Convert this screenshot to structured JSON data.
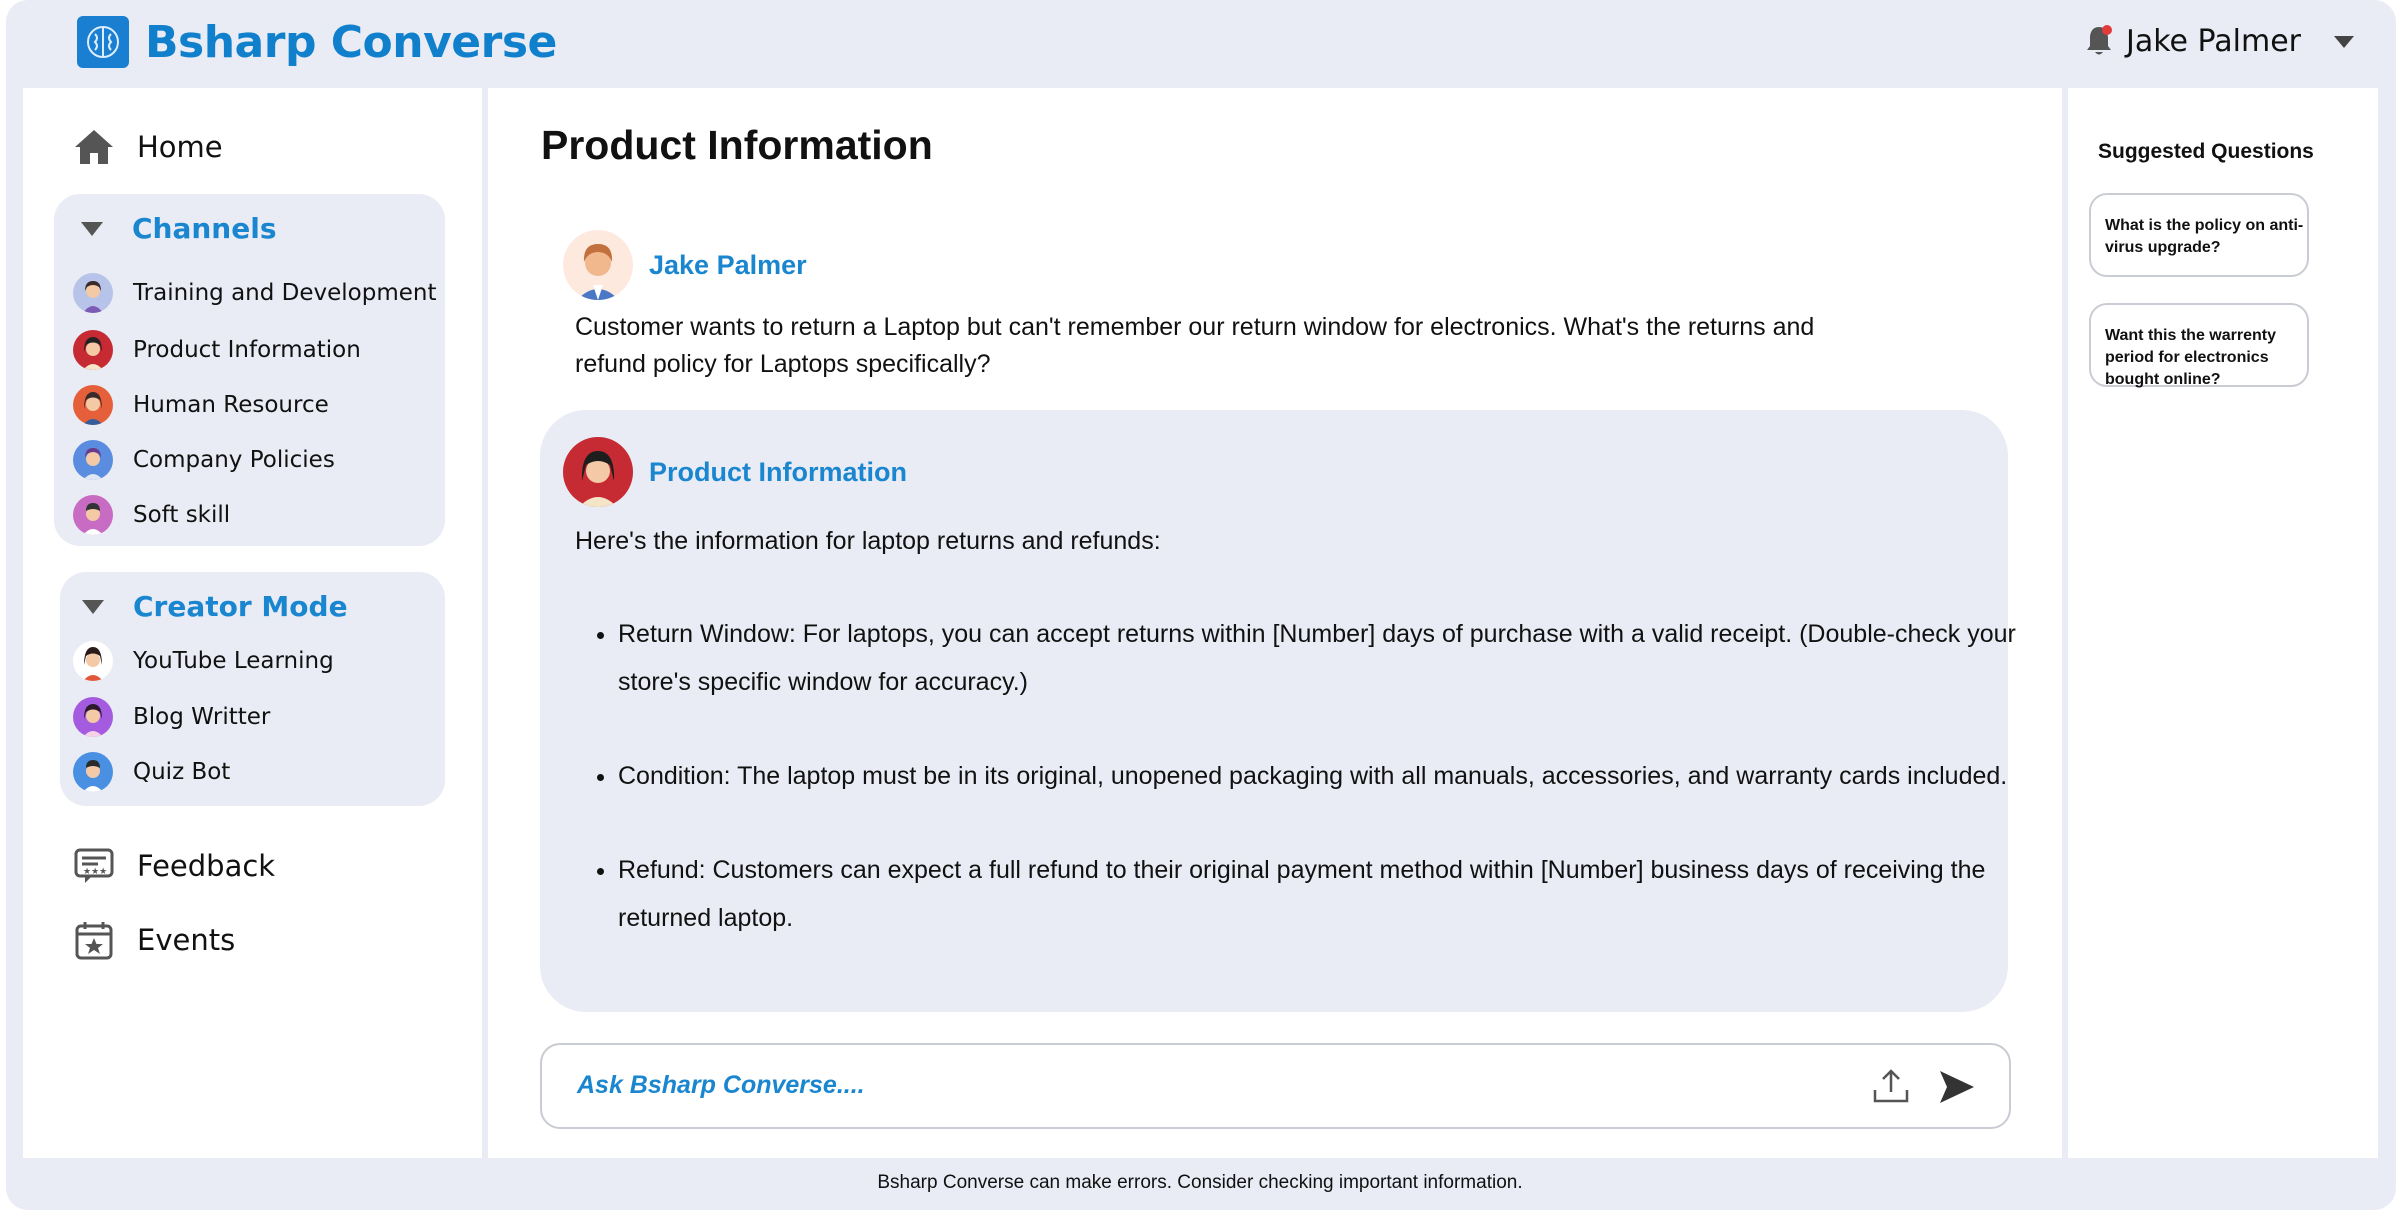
{
  "header": {
    "brand": "Bsharp Converse",
    "user_name": "Jake Palmer"
  },
  "sidebar": {
    "home_label": "Home",
    "channels": {
      "title": "Channels",
      "items": [
        {
          "label": "Training and Development"
        },
        {
          "label": "Product Information"
        },
        {
          "label": "Human Resource"
        },
        {
          "label": "Company Policies"
        },
        {
          "label": "Soft skill"
        }
      ]
    },
    "creator": {
      "title": "Creator Mode",
      "items": [
        {
          "label": "YouTube Learning"
        },
        {
          "label": "Blog Writter"
        },
        {
          "label": "Quiz Bot"
        }
      ]
    },
    "feedback_label": "Feedback",
    "events_label": "Events"
  },
  "main": {
    "title": "Product Information",
    "user_message": {
      "sender": "Jake Palmer",
      "text": "Customer wants to return a Laptop but can't remember our return window for electronics. What's the returns and refund policy for Laptops specifically?"
    },
    "bot_message": {
      "sender": "Product Information",
      "intro": "Here's the information for laptop returns and refunds:",
      "bullets": [
        "Return Window: For laptops, you can accept returns within [Number] days of purchase with a valid receipt. (Double-check your store's specific window for accuracy.)",
        "Condition: The laptop must be in its original, unopened packaging with all manuals, accessories, and warranty cards included.",
        "Refund: Customers can expect a full refund to their original payment method within [Number] business days of receiving the returned laptop."
      ]
    },
    "input_placeholder": "Ask Bsharp Converse...."
  },
  "suggestions": {
    "title": "Suggested Questions",
    "items": [
      "What is the policy on anti-virus upgrade?",
      "Want this the warrenty period for electronics bought online?"
    ]
  },
  "footer": {
    "note": "Bsharp Converse can make errors. Consider checking important information."
  },
  "colors": {
    "accent": "#1a86d0",
    "brand": "#1180cc",
    "background": "#e9ecf4"
  }
}
